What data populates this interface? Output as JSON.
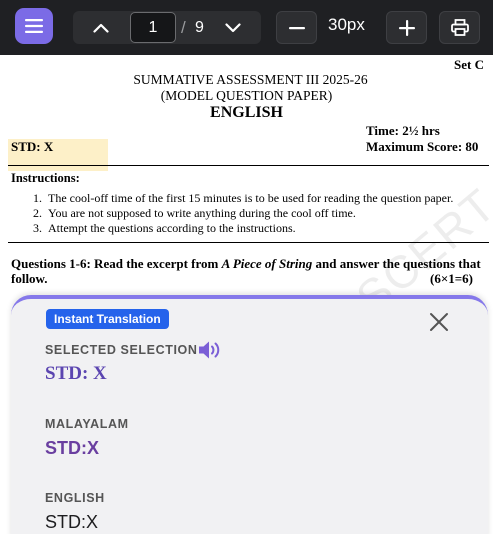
{
  "toolbar": {
    "current_page": "1",
    "separator": "/",
    "total_pages": "9",
    "zoom": "30px"
  },
  "document": {
    "set": "Set C",
    "heading1": "SUMMATIVE ASSESSMENT III  2025-26",
    "heading2": "(MODEL QUESTION PAPER)",
    "subject": "ENGLISH",
    "time": "Time: 2½ hrs",
    "max_score": "Maximum Score: 80",
    "std": "STD: X",
    "instructions_title": "Instructions:",
    "instructions": [
      {
        "num": "1.",
        "text": "The cool-off time of the first 15 minutes is to be used for reading the question paper."
      },
      {
        "num": "2.",
        "text": "You are not supposed to write anything during the cool off time."
      },
      {
        "num": "3.",
        "text": "Attempt the questions according to the instructions."
      }
    ],
    "question_intro": "Questions 1-6: Read the excerpt from ",
    "question_title": "A Piece of String",
    "question_rest": " and answer the questions that follow.",
    "question_marks": "(6×1=6)",
    "watermark": "SCERT Ke"
  },
  "translation": {
    "badge": "Instant Translation",
    "selected_label": "SELECTED SELECTION",
    "selected_value": "STD: X",
    "malayalam_label": "MALAYALAM",
    "malayalam_value": "STD:X",
    "english_label": "ENGLISH",
    "english_value": "STD:X"
  },
  "colors": {
    "accent": "#7b6be6",
    "badge": "#2563eb",
    "highlight": "#fdf0c8"
  },
  "icons": [
    "menu-icon",
    "chevron-up-icon",
    "chevron-down-icon",
    "minus-icon",
    "plus-icon",
    "print-icon",
    "close-icon",
    "speaker-icon"
  ]
}
